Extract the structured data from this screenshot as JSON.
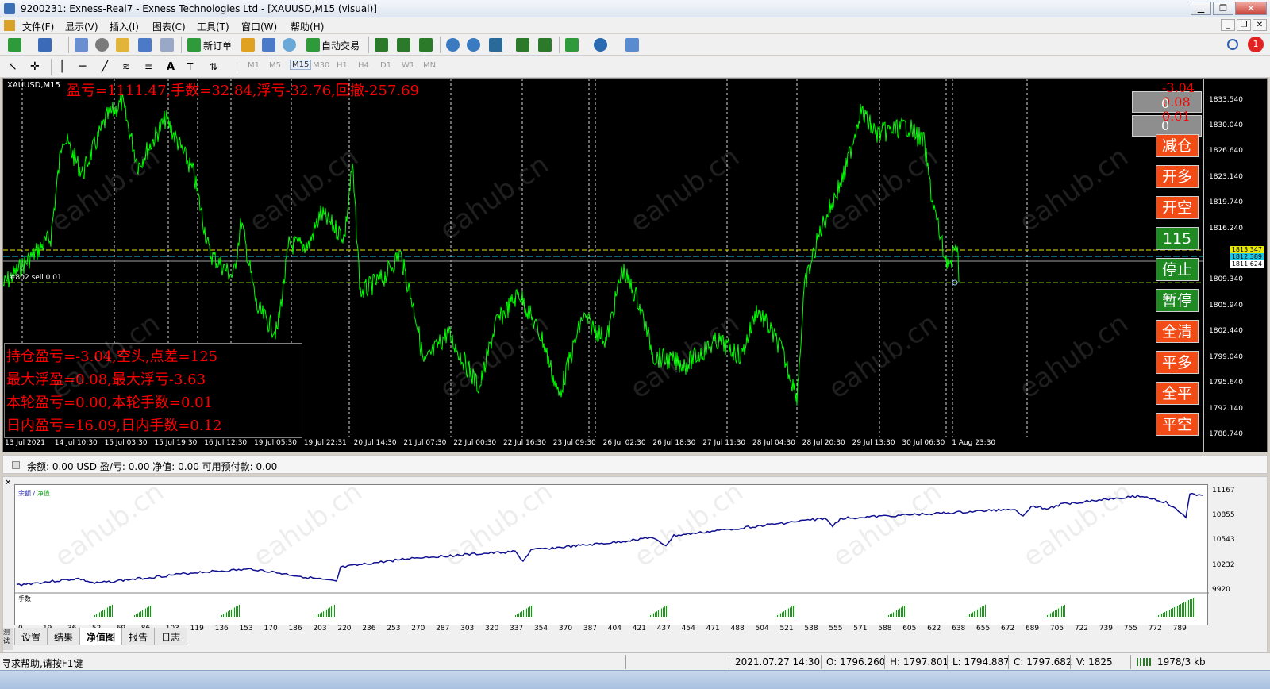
{
  "window": {
    "title": "9200231: Exness-Real7 - Exness Technologies Ltd - [XAUUSD,M15 (visual)]",
    "min": "▁",
    "max": "❐",
    "close": "✕"
  },
  "menu": {
    "items": [
      "文件(F)",
      "显示(V)",
      "插入(I)",
      "图表(C)",
      "工具(T)",
      "窗口(W)",
      "帮助(H)"
    ]
  },
  "toolbar": {
    "new_order": "新订单",
    "auto_trading": "自动交易",
    "timeframes": [
      "M1",
      "M5",
      "M15",
      "M30",
      "H1",
      "H4",
      "D1",
      "W1",
      "MN"
    ],
    "active_timeframe": "M15",
    "text_tool": "A",
    "notification_count": "1"
  },
  "chart": {
    "symbol": "XAUUSD,M15",
    "headline": "盈亏=1111.47,手数=32.84,浮亏-32.76,回撤-257.69",
    "order_label": "#802 sell 0.01",
    "info": [
      "持仓盈亏=-3.04,空头,点差=125",
      "最大浮盈=0.08,最大浮亏-3.63",
      "本轮盈亏=0.00,本轮手数=0.01",
      "日内盈亏=16.09,日内手数=0.12"
    ],
    "panel_values": [
      "-3.04",
      "0.08",
      "0",
      "0.01",
      "0"
    ],
    "buttons": [
      {
        "label": "减仓",
        "color": "red"
      },
      {
        "label": "开多",
        "color": "red"
      },
      {
        "label": "开空",
        "color": "red"
      },
      {
        "label": "115",
        "color": "green"
      },
      {
        "label": "停止",
        "color": "green"
      },
      {
        "label": "暂停",
        "color": "green"
      },
      {
        "label": "全清",
        "color": "red"
      },
      {
        "label": "平多",
        "color": "red"
      },
      {
        "label": "全平",
        "color": "red"
      },
      {
        "label": "平空",
        "color": "red"
      }
    ],
    "y_labels": [
      "1833.540",
      "1830.040",
      "1826.640",
      "1823.140",
      "1819.740",
      "1816.240",
      "1809.340",
      "1805.940",
      "1802.440",
      "1799.040",
      "1795.640",
      "1792.140",
      "1788.740"
    ],
    "price_boxes": [
      "1813.347",
      "1812.389",
      "1811.624"
    ],
    "x_labels": [
      "13 Jul 2021",
      "14 Jul 10:30",
      "15 Jul 03:30",
      "15 Jul 19:30",
      "16 Jul 12:30",
      "19 Jul 05:30",
      "19 Jul 22:31",
      "20 Jul 14:30",
      "21 Jul 07:30",
      "22 Jul 00:30",
      "22 Jul 16:30",
      "23 Jul 09:30",
      "26 Jul 02:30",
      "26 Jul 18:30",
      "27 Jul 11:30",
      "28 Jul 04:30",
      "28 Jul 20:30",
      "29 Jul 13:30",
      "30 Jul 06:30",
      "1 Aug 23:30"
    ],
    "colors": {
      "price": "#00ff00",
      "headline": "#ff0000",
      "level_yellow": "#e8e800",
      "level_cyan": "#18c8e8"
    }
  },
  "balance_bar": {
    "text": "余额: 0.00 USD   盈/亏: 0.00   净值: 0.00   可用预付款: 0.00"
  },
  "tester": {
    "legend_balance": "余额",
    "legend_sep": " / ",
    "legend_equity": "净值",
    "lots_label": "手数",
    "y_labels": [
      "11167",
      "10855",
      "10543",
      "10232",
      "9920"
    ],
    "x_labels": [
      "0",
      "19",
      "36",
      "52",
      "69",
      "86",
      "103",
      "119",
      "136",
      "153",
      "170",
      "186",
      "203",
      "220",
      "236",
      "253",
      "270",
      "287",
      "303",
      "320",
      "337",
      "354",
      "370",
      "387",
      "404",
      "421",
      "437",
      "454",
      "471",
      "488",
      "504",
      "521",
      "538",
      "555",
      "571",
      "588",
      "605",
      "622",
      "638",
      "655",
      "672",
      "689",
      "705",
      "722",
      "739",
      "755",
      "772",
      "789"
    ],
    "tabs": [
      "设置",
      "结果",
      "净值图",
      "报告",
      "日志"
    ],
    "active_tab": "净值图",
    "side_tab": "测试"
  },
  "status": {
    "help": "寻求帮助,请按F1键",
    "datetime": "2021.07.27 14:30",
    "open": "O: 1796.260",
    "high": "H: 1797.801",
    "low": "L: 1794.887",
    "close": "C: 1797.682",
    "volume": "V: 1825",
    "traffic": "1978/3 kb"
  },
  "watermark": "eahub.cn"
}
